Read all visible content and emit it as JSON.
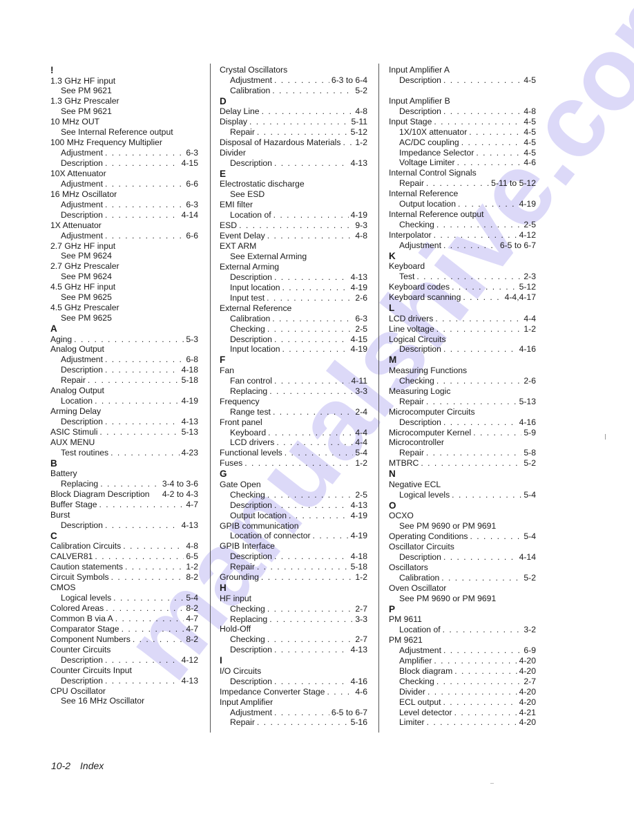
{
  "watermark": "manualshive.com",
  "footer": {
    "page_number": "10-2",
    "section": "Index"
  },
  "columns": [
    [
      {
        "type": "letter",
        "text": "!"
      },
      {
        "type": "main",
        "term": "1.3 GHz HF input"
      },
      {
        "type": "sub",
        "term": "See PM 9621"
      },
      {
        "type": "main",
        "term": "1.3 GHz Prescaler"
      },
      {
        "type": "sub",
        "term": "See PM 9621"
      },
      {
        "type": "main",
        "term": "10 MHz OUT"
      },
      {
        "type": "sub",
        "term": "See Internal Reference output"
      },
      {
        "type": "main",
        "term": "100 MHz Frequency Multiplier"
      },
      {
        "type": "sub",
        "term": "Adjustment",
        "page": "6-3"
      },
      {
        "type": "sub",
        "term": "Description",
        "page": "4-15"
      },
      {
        "type": "main",
        "term": "10X Attenuator"
      },
      {
        "type": "sub",
        "term": "Adjustment",
        "page": "6-6"
      },
      {
        "type": "main",
        "term": "16 MHz Oscillator"
      },
      {
        "type": "sub",
        "term": "Adjustment",
        "page": "6-3"
      },
      {
        "type": "sub",
        "term": "Description",
        "page": "4-14"
      },
      {
        "type": "main",
        "term": "1X Attenuator"
      },
      {
        "type": "sub",
        "term": "Adjustment",
        "page": "6-6"
      },
      {
        "type": "main",
        "term": "2.7 GHz HF input"
      },
      {
        "type": "sub",
        "term": "See PM 9624"
      },
      {
        "type": "main",
        "term": "2.7 GHz Prescaler"
      },
      {
        "type": "sub",
        "term": "See PM 9624"
      },
      {
        "type": "main",
        "term": "4.5 GHz HF input"
      },
      {
        "type": "sub",
        "term": "See PM 9625"
      },
      {
        "type": "main",
        "term": "4.5 GHz Prescaler"
      },
      {
        "type": "sub",
        "term": "See PM 9625"
      },
      {
        "type": "letter",
        "text": "A"
      },
      {
        "type": "main",
        "term": "Aging",
        "page": "5-3"
      },
      {
        "type": "main",
        "term": "Analog Output"
      },
      {
        "type": "sub",
        "term": "Adjustment",
        "page": "6-8"
      },
      {
        "type": "sub",
        "term": "Description",
        "page": "4-18"
      },
      {
        "type": "sub",
        "term": "Repair",
        "page": "5-18"
      },
      {
        "type": "main",
        "term": "Analog Output"
      },
      {
        "type": "sub",
        "term": "Location",
        "page": "4-19"
      },
      {
        "type": "main",
        "term": "Arming Delay"
      },
      {
        "type": "sub",
        "term": "Description",
        "page": "4-13"
      },
      {
        "type": "main",
        "term": "ASIC Stimuli",
        "page": "5-13"
      },
      {
        "type": "main",
        "term": "AUX MENU"
      },
      {
        "type": "sub",
        "term": "Test routines",
        "page": "4-23"
      },
      {
        "type": "letter",
        "text": "B"
      },
      {
        "type": "main",
        "term": "Battery"
      },
      {
        "type": "sub",
        "term": "Replacing",
        "page": "3-4 to 3-6"
      },
      {
        "type": "main",
        "term": "Block Diagram Description",
        "page": "4-2 to 4-3",
        "noleader": true
      },
      {
        "type": "main",
        "term": "Buffer Stage",
        "page": "4-7"
      },
      {
        "type": "main",
        "term": "Burst"
      },
      {
        "type": "sub",
        "term": "Description",
        "page": "4-13"
      },
      {
        "type": "letter",
        "text": "C"
      },
      {
        "type": "main",
        "term": "Calibration Circuits",
        "page": "4-8"
      },
      {
        "type": "main",
        "term": "CALVER81",
        "page": "6-5"
      },
      {
        "type": "main",
        "term": "Caution statements",
        "page": "1-2"
      },
      {
        "type": "main",
        "term": "Circuit Symbols",
        "page": "8-2"
      },
      {
        "type": "main",
        "term": "CMOS"
      },
      {
        "type": "sub",
        "term": "Logical levels",
        "page": "5-4"
      },
      {
        "type": "main",
        "term": "Colored Areas",
        "page": "8-2"
      },
      {
        "type": "main",
        "term": "Common B via A",
        "page": "4-7"
      },
      {
        "type": "main",
        "term": "Comparator Stage",
        "page": "4-7"
      },
      {
        "type": "main",
        "term": "Component Numbers",
        "page": "8-2"
      },
      {
        "type": "main",
        "term": "Counter Circuits"
      },
      {
        "type": "sub",
        "term": "Description",
        "page": "4-12"
      },
      {
        "type": "main",
        "term": "Counter Circuits Input"
      },
      {
        "type": "sub",
        "term": "Description",
        "page": "4-13"
      },
      {
        "type": "main",
        "term": "CPU Oscillator"
      },
      {
        "type": "sub",
        "term": "See 16 MHz Oscillator"
      }
    ],
    [
      {
        "type": "main",
        "term": "Crystal Oscillators"
      },
      {
        "type": "sub",
        "term": "Adjustment",
        "page": "6-3 to 6-4"
      },
      {
        "type": "sub",
        "term": "Calibration",
        "page": "5-2"
      },
      {
        "type": "letter",
        "text": "D"
      },
      {
        "type": "main",
        "term": "Delay Line",
        "page": "4-8"
      },
      {
        "type": "main",
        "term": "Display",
        "page": "5-11"
      },
      {
        "type": "sub",
        "term": "Repair",
        "page": "5-12"
      },
      {
        "type": "main",
        "term": "Disposal of Hazardous Materials",
        "page": "1-2"
      },
      {
        "type": "main",
        "term": "Divider"
      },
      {
        "type": "sub",
        "term": "Description",
        "page": "4-13"
      },
      {
        "type": "letter",
        "text": "E"
      },
      {
        "type": "main",
        "term": "Electrostatic discharge"
      },
      {
        "type": "sub",
        "term": "See ESD"
      },
      {
        "type": "main",
        "term": "EMI filter"
      },
      {
        "type": "sub",
        "term": "Location of",
        "page": "4-19"
      },
      {
        "type": "main",
        "term": "ESD",
        "page": "9-3"
      },
      {
        "type": "main",
        "term": "Event Delay",
        "page": "4-8"
      },
      {
        "type": "main",
        "term": "EXT ARM"
      },
      {
        "type": "sub",
        "term": "See External Arming"
      },
      {
        "type": "main",
        "term": "External Arming"
      },
      {
        "type": "sub",
        "term": "Description",
        "page": "4-13"
      },
      {
        "type": "sub",
        "term": "Input location",
        "page": "4-19"
      },
      {
        "type": "sub",
        "term": "Input test",
        "page": "2-6"
      },
      {
        "type": "main",
        "term": "External Reference"
      },
      {
        "type": "sub",
        "term": "Calibration",
        "page": "6-3"
      },
      {
        "type": "sub",
        "term": "Checking",
        "page": "2-5"
      },
      {
        "type": "sub",
        "term": "Description",
        "page": "4-15"
      },
      {
        "type": "sub",
        "term": "Input location",
        "page": "4-19"
      },
      {
        "type": "letter",
        "text": "F"
      },
      {
        "type": "main",
        "term": "Fan"
      },
      {
        "type": "sub",
        "term": "Fan control",
        "page": "4-11"
      },
      {
        "type": "sub",
        "term": "Replacing",
        "page": "3-3"
      },
      {
        "type": "main",
        "term": "Frequency"
      },
      {
        "type": "sub",
        "term": "Range test",
        "page": "2-4"
      },
      {
        "type": "main",
        "term": "Front panel"
      },
      {
        "type": "sub",
        "term": "Keyboard",
        "page": "4-4"
      },
      {
        "type": "sub",
        "term": "LCD drivers",
        "page": "4-4"
      },
      {
        "type": "main",
        "term": "Functional levels",
        "page": "5-4"
      },
      {
        "type": "main",
        "term": "Fuses",
        "page": "1-2"
      },
      {
        "type": "letter",
        "text": "G"
      },
      {
        "type": "main",
        "term": "Gate Open"
      },
      {
        "type": "sub",
        "term": "Checking",
        "page": "2-5"
      },
      {
        "type": "sub",
        "term": "Description",
        "page": "4-13"
      },
      {
        "type": "sub",
        "term": "Output location",
        "page": "4-19"
      },
      {
        "type": "main",
        "term": "GPIB communication"
      },
      {
        "type": "sub",
        "term": "Location of connector",
        "page": "4-19"
      },
      {
        "type": "main",
        "term": "GPIB Interface"
      },
      {
        "type": "sub",
        "term": "Description",
        "page": "4-18"
      },
      {
        "type": "sub",
        "term": "Repair",
        "page": "5-18"
      },
      {
        "type": "main",
        "term": "Grounding",
        "page": "1-2"
      },
      {
        "type": "letter",
        "text": "H"
      },
      {
        "type": "main",
        "term": "HF input"
      },
      {
        "type": "sub",
        "term": "Checking",
        "page": "2-7"
      },
      {
        "type": "sub",
        "term": "Replacing",
        "page": "3-3"
      },
      {
        "type": "main",
        "term": "Hold-Off"
      },
      {
        "type": "sub",
        "term": "Checking",
        "page": "2-7"
      },
      {
        "type": "sub",
        "term": "Description",
        "page": "4-13"
      },
      {
        "type": "letter",
        "text": "I"
      },
      {
        "type": "main",
        "term": "I/O Circuits"
      },
      {
        "type": "sub",
        "term": "Description",
        "page": "4-16"
      },
      {
        "type": "main",
        "term": "Impedance Converter Stage",
        "page": "4-6"
      },
      {
        "type": "main",
        "term": "Input Amplifier"
      },
      {
        "type": "sub",
        "term": "Adjustment",
        "page": "6-5 to 6-7"
      },
      {
        "type": "sub",
        "term": "Repair",
        "page": "5-16"
      }
    ],
    [
      {
        "type": "main",
        "term": "Input Amplifier A"
      },
      {
        "type": "sub",
        "term": "Description",
        "page": "4-5"
      },
      {
        "type": "blank"
      },
      {
        "type": "main",
        "term": "Input Amplifier B"
      },
      {
        "type": "sub",
        "term": "Description",
        "page": "4-8"
      },
      {
        "type": "main",
        "term": "Input Stage",
        "page": "4-5"
      },
      {
        "type": "sub",
        "term": "1X/10X attenuator",
        "page": "4-5"
      },
      {
        "type": "sub",
        "term": "AC/DC coupling",
        "page": "4-5"
      },
      {
        "type": "sub",
        "term": "Impedance Selector",
        "page": "4-5"
      },
      {
        "type": "sub",
        "term": "Voltage Limiter",
        "page": "4-6"
      },
      {
        "type": "main",
        "term": "Internal Control Signals"
      },
      {
        "type": "sub",
        "term": "Repair",
        "page": "5-11 to 5-12"
      },
      {
        "type": "main",
        "term": "Internal Reference"
      },
      {
        "type": "sub",
        "term": "Output location",
        "page": "4-19"
      },
      {
        "type": "main",
        "term": "Internal Reference output"
      },
      {
        "type": "sub",
        "term": "Checking",
        "page": "2-5"
      },
      {
        "type": "main",
        "term": "Interpolator",
        "page": "4-12"
      },
      {
        "type": "sub",
        "term": "Adjustment",
        "page": "6-5 to 6-7"
      },
      {
        "type": "letter",
        "text": "K"
      },
      {
        "type": "main",
        "term": "Keyboard"
      },
      {
        "type": "sub",
        "term": "Test",
        "page": "2-3"
      },
      {
        "type": "main",
        "term": "Keyboard codes",
        "page": "5-12"
      },
      {
        "type": "main",
        "term": "Keyboard scanning",
        "page": "4-4,4-17"
      },
      {
        "type": "letter",
        "text": "L"
      },
      {
        "type": "main",
        "term": "LCD drivers",
        "page": "4-4"
      },
      {
        "type": "main",
        "term": "Line voltage",
        "page": "1-2"
      },
      {
        "type": "main",
        "term": "Logical Circuits"
      },
      {
        "type": "sub",
        "term": "Description",
        "page": "4-16"
      },
      {
        "type": "letter",
        "text": "M"
      },
      {
        "type": "main",
        "term": "Measuring Functions"
      },
      {
        "type": "sub",
        "term": "Checking",
        "page": "2-6"
      },
      {
        "type": "main",
        "term": "Measuring Logic"
      },
      {
        "type": "sub",
        "term": "Repair",
        "page": "5-13"
      },
      {
        "type": "main",
        "term": "Microcomputer Circuits"
      },
      {
        "type": "sub",
        "term": "Description",
        "page": "4-16"
      },
      {
        "type": "main",
        "term": "Microcomputer Kernel",
        "page": "5-9"
      },
      {
        "type": "main",
        "term": "Microcontroller"
      },
      {
        "type": "sub",
        "term": "Repair",
        "page": "5-8"
      },
      {
        "type": "main",
        "term": "MTBRC",
        "page": "5-2"
      },
      {
        "type": "letter",
        "text": "N"
      },
      {
        "type": "main",
        "term": "Negative ECL"
      },
      {
        "type": "sub",
        "term": "Logical levels",
        "page": "5-4"
      },
      {
        "type": "letter",
        "text": "O"
      },
      {
        "type": "main",
        "term": "OCXO"
      },
      {
        "type": "sub",
        "term": "See PM 9690 or PM 9691"
      },
      {
        "type": "main",
        "term": "Operating Conditions",
        "page": "5-4"
      },
      {
        "type": "main",
        "term": "Oscillator Circuits"
      },
      {
        "type": "sub",
        "term": "Description",
        "page": "4-14"
      },
      {
        "type": "main",
        "term": "Oscillators"
      },
      {
        "type": "sub",
        "term": "Calibration",
        "page": "5-2"
      },
      {
        "type": "main",
        "term": "Oven Oscillator"
      },
      {
        "type": "sub",
        "term": "See PM 9690 or PM 9691"
      },
      {
        "type": "letter",
        "text": "P"
      },
      {
        "type": "main",
        "term": "PM 9611"
      },
      {
        "type": "sub",
        "term": "Location of",
        "page": "3-2"
      },
      {
        "type": "main",
        "term": "PM 9621"
      },
      {
        "type": "sub",
        "term": "Adjustment",
        "page": "6-9"
      },
      {
        "type": "sub",
        "term": "Amplifier",
        "page": "4-20"
      },
      {
        "type": "sub",
        "term": "Block diagram",
        "page": "4-20"
      },
      {
        "type": "sub",
        "term": "Checking",
        "page": "2-7"
      },
      {
        "type": "sub",
        "term": "Divider",
        "page": "4-20"
      },
      {
        "type": "sub",
        "term": "ECL output",
        "page": "4-20"
      },
      {
        "type": "sub",
        "term": "Level detector",
        "page": "4-21"
      },
      {
        "type": "sub",
        "term": "Limiter",
        "page": "4-20"
      }
    ]
  ]
}
